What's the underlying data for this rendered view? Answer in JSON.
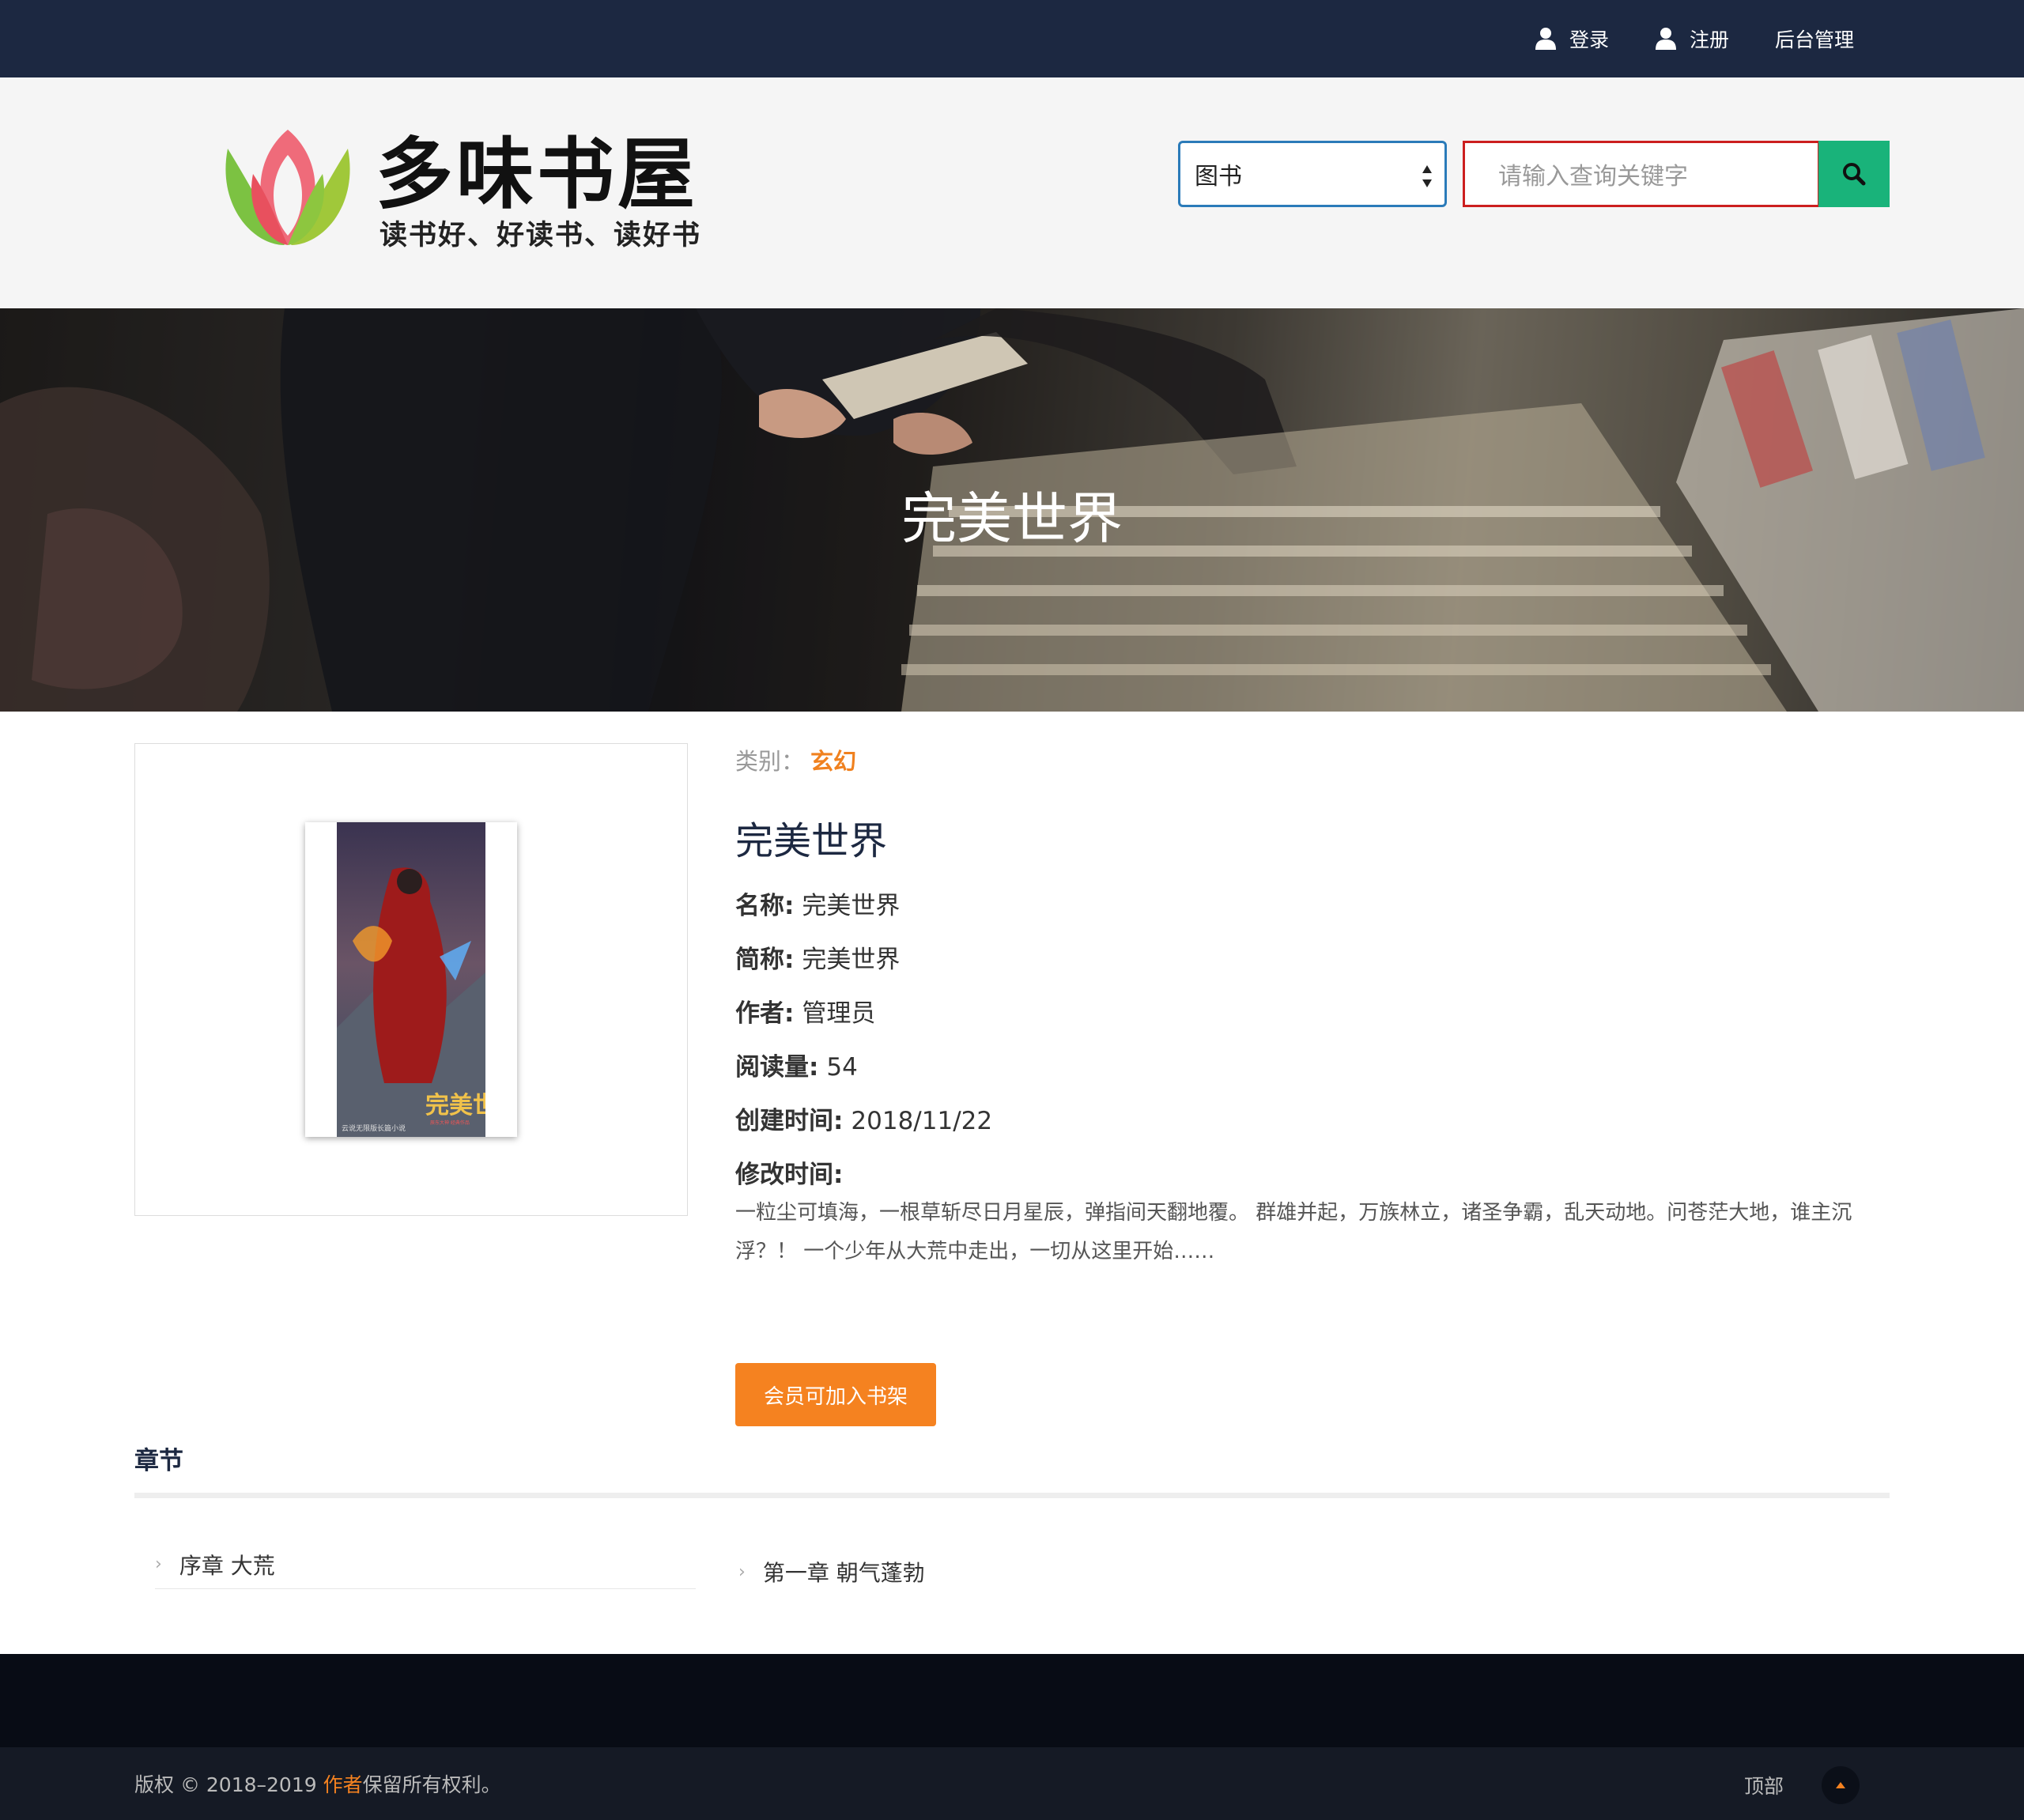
{
  "topbar": {
    "login": "登录",
    "register": "注册",
    "admin": "后台管理"
  },
  "header": {
    "logo_title": "多味书屋",
    "logo_slogan": "读书好、好读书、读好书",
    "search_type": "图书",
    "search_placeholder": "请输入查询关键字"
  },
  "banner": {
    "title": "完美世界"
  },
  "book": {
    "category_label": "类别：",
    "category_value": "玄幻",
    "title": "完美世界",
    "name_label": "名称:",
    "name_value": "完美世界",
    "short_label": "简称:",
    "short_value": "完美世界",
    "author_label": "作者:",
    "author_value": "管理员",
    "reads_label": "阅读量:",
    "reads_value": "54",
    "created_label": "创建时间:",
    "created_value": "2018/11/22",
    "modified_label": "修改时间:",
    "description": "一粒尘可填海，一根草斩尽日月星辰，弹指间天翻地覆。 群雄并起，万族林立，诸圣争霸，乱天动地。问苍茫大地，谁主沉浮？！ 一个少年从大荒中走出，一切从这里开始……",
    "cover_text": "完美世",
    "cover_caption": "云说无限版长篇小说",
    "cover_subcaption": "辰东大神 经典作品"
  },
  "actions": {
    "add_shelf": "会员可加入书架"
  },
  "chapters": {
    "title": "章节",
    "items": [
      "序章 大荒",
      "第一章 朝气蓬勃"
    ]
  },
  "footer": {
    "copyright_prefix": "版权 © 2018–2019 ",
    "copyright_author": "作者",
    "copyright_suffix": "保留所有权利。",
    "to_top": "顶部"
  },
  "colors": {
    "topbar": "#1c2841",
    "accent": "#f58220",
    "search_button": "#19b37a",
    "footer": "#080c15"
  },
  "icons": {
    "login": "user-icon",
    "register": "user-icon",
    "search": "search-icon",
    "chapter": "chevron-right-icon",
    "to_top": "caret-up-icon"
  }
}
